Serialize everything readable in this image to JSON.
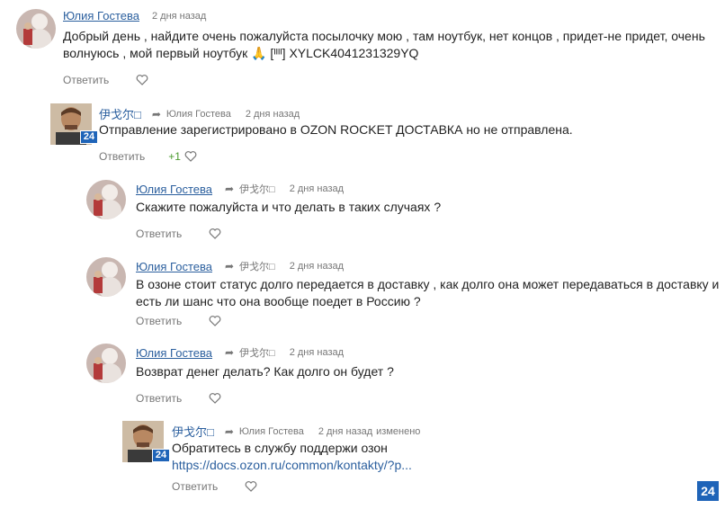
{
  "comments": [
    {
      "author": "Юлия Гостева",
      "reply_to": "",
      "time": "2 дня назад",
      "edited": "",
      "text": "Добрый день , найдите очень пожалуйста посылочку мою , там ноутбук, нет концов , придет-не придет, очень волнуюсь , мой первый ноутбук 🙏 [ᴵᴵᴵᴵ] XYLCK4041231329YQ",
      "reply_label": "Ответить",
      "likes": ""
    },
    {
      "author": "伊戈尔□",
      "reply_to": "Юлия Гостева",
      "time": "2 дня назад",
      "edited": "",
      "badge": "24",
      "text": "Отправление зарегистрировано в OZON ROCKET ДОСТАВКА но не отправлена.",
      "reply_label": "Ответить",
      "likes": "+1"
    },
    {
      "author": "Юлия Гостева",
      "reply_to": "伊戈尔□",
      "time": "2 дня назад",
      "edited": "",
      "text": "Скажите пожалуйста и что делать в таких случаях ?",
      "reply_label": "Ответить",
      "likes": ""
    },
    {
      "author": "Юлия Гостева",
      "reply_to": "伊戈尔□",
      "time": "2 дня назад",
      "edited": "",
      "text": "В озоне стоит статус долго передается в доставку , как долго она может передаваться в доставку и есть ли шанс что она вообще поедет в Россию ?",
      "reply_label": "Ответить",
      "likes": ""
    },
    {
      "author": "Юлия Гостева",
      "reply_to": "伊戈尔□",
      "time": "2 дня назад",
      "edited": "",
      "text": "Возврат денег делать? Как долго он будет ?",
      "reply_label": "Ответить",
      "likes": ""
    },
    {
      "author": "伊戈尔□",
      "reply_to": "Юлия Гостева",
      "time": "2 дня назад",
      "edited": "изменено",
      "badge": "24",
      "text": "Обратитесь в службу поддержи озон",
      "link": "https://docs.ozon.ru/common/kontakty/?p...",
      "reply_label": "Ответить",
      "likes": ""
    }
  ],
  "corner_badge": "24",
  "colors": {
    "link": "#2b5f9e",
    "badge": "#1f64b8",
    "plus": "#4a9a2e"
  }
}
